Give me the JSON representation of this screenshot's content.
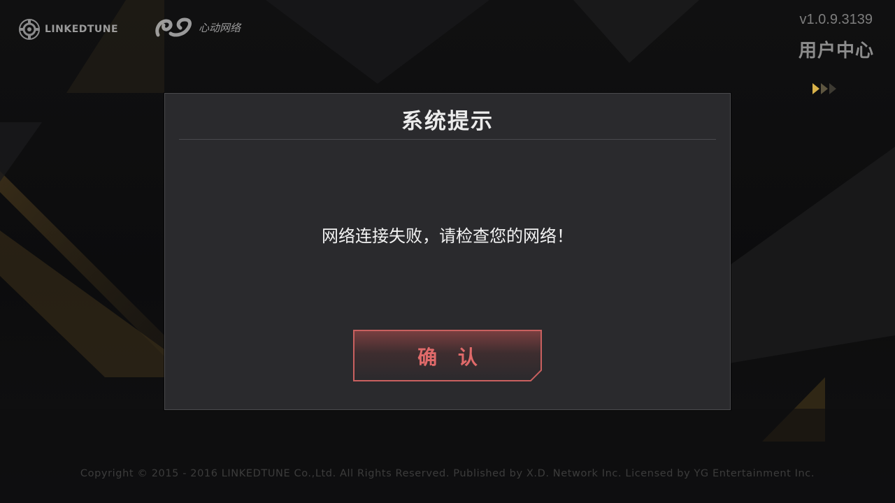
{
  "header": {
    "logo_linkedtune": "LINKEDTUNE",
    "logo_xd": "心动网络",
    "version": "v1.0.9.3139",
    "user_center": "用户中心"
  },
  "dialog": {
    "title": "系统提示",
    "message": "网络连接失败，请检查您的网络！",
    "confirm_label": "确 认"
  },
  "footer": {
    "copyright": "Copyright © 2015 - 2016 LINKEDTUNE Co.,Ltd. All Rights Reserved. Published by X.D. Network Inc. Licensed by YG Entertainment Inc."
  },
  "colors": {
    "accent_gold": "#d9b24a",
    "confirm_text": "#e06a6a",
    "confirm_border": "#c9605f",
    "dialog_bg": "#2a2a2d"
  },
  "icons": {
    "linkedtune_logo": "gear-circle-icon",
    "xd_logo": "xd-swirl-icon",
    "more_arrows": "triple-chevron-right-icon"
  }
}
